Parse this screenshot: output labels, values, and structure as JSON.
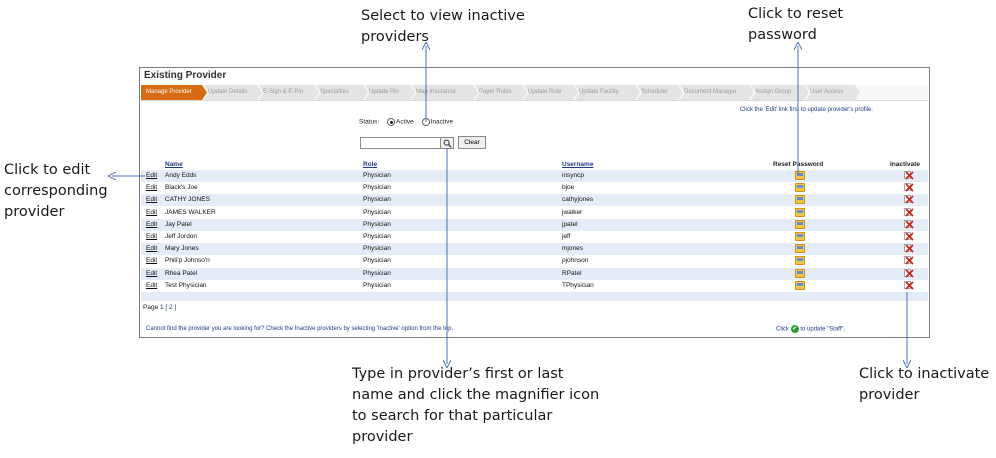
{
  "callouts": {
    "inactive": [
      "Select to view inactive",
      "providers"
    ],
    "reset": [
      "Click to reset",
      "password"
    ],
    "edit": [
      "Click to edit",
      "corresponding",
      "provider"
    ],
    "search": [
      "Type in provider’s first or last",
      "name and click the magnifier  icon",
      "to search for that particular",
      "provider"
    ],
    "inactivate": [
      "Click to inactivate",
      "provider"
    ]
  },
  "panel": {
    "title": "Existing Provider",
    "tabs": [
      "Manage Provider",
      "Update Details",
      "E-Sign & E-Pin",
      "Specialties",
      "Update Pin",
      "Map Insurance",
      "Payer Rules",
      "Update Role",
      "Update Facility",
      "Scheduler",
      "Document Manager",
      "Assign Group",
      "User Access"
    ],
    "active_tab": "Manage Provider",
    "hint": "Click the 'Edit' link first to update provider's profile.",
    "status": {
      "label": "Status:",
      "active": "Active",
      "inactive": "Inactive",
      "selected": "Active"
    },
    "search": {
      "value": "",
      "clear_label": "Clear"
    },
    "columns": {
      "name": "Name",
      "role": "Role",
      "username": "Username",
      "reset": "Reset Password",
      "inactivate": "Inactivate"
    },
    "edit_label": "Edit",
    "rows": [
      {
        "name": "Andy Edds",
        "role": "Physician",
        "username": "insyncp"
      },
      {
        "name": "Black's Joe",
        "role": "Physician",
        "username": "bjoe"
      },
      {
        "name": "CATHY JONES",
        "role": "Physician",
        "username": "cathyjones"
      },
      {
        "name": "JAMES WALKER",
        "role": "Physician",
        "username": "jwalker"
      },
      {
        "name": "Jay Patel",
        "role": "Physician",
        "username": "jpatel"
      },
      {
        "name": "Jeff Jordon",
        "role": "Physician",
        "username": "jeff"
      },
      {
        "name": "Mary Jones",
        "role": "Physician",
        "username": "mjones"
      },
      {
        "name": "Phili'p Johnso'n",
        "role": "Physician",
        "username": "pjohnson"
      },
      {
        "name": "Rhea Patel",
        "role": "Physician",
        "username": "RPatel"
      },
      {
        "name": "Test Physician",
        "role": "Physician",
        "username": "TPhysician"
      }
    ],
    "pager": {
      "label": "Page 1",
      "next": "[ 2 ]"
    },
    "bottom_note": "Cannot find the provider you are looking for? Check the Inactive providers by selecting 'Inactive' option from the top.",
    "staff_note": {
      "prefix": "Click",
      "suffix": "to update \"Staff\"."
    }
  },
  "colors": {
    "active_tab": "#d76b12",
    "alt_row": "#e4ecf7",
    "link": "#1f3c88",
    "leader_line": "#4a73b8"
  },
  "icons": [
    "search-icon",
    "reset-password-icon",
    "inactivate-x-icon",
    "green-check-icon"
  ]
}
